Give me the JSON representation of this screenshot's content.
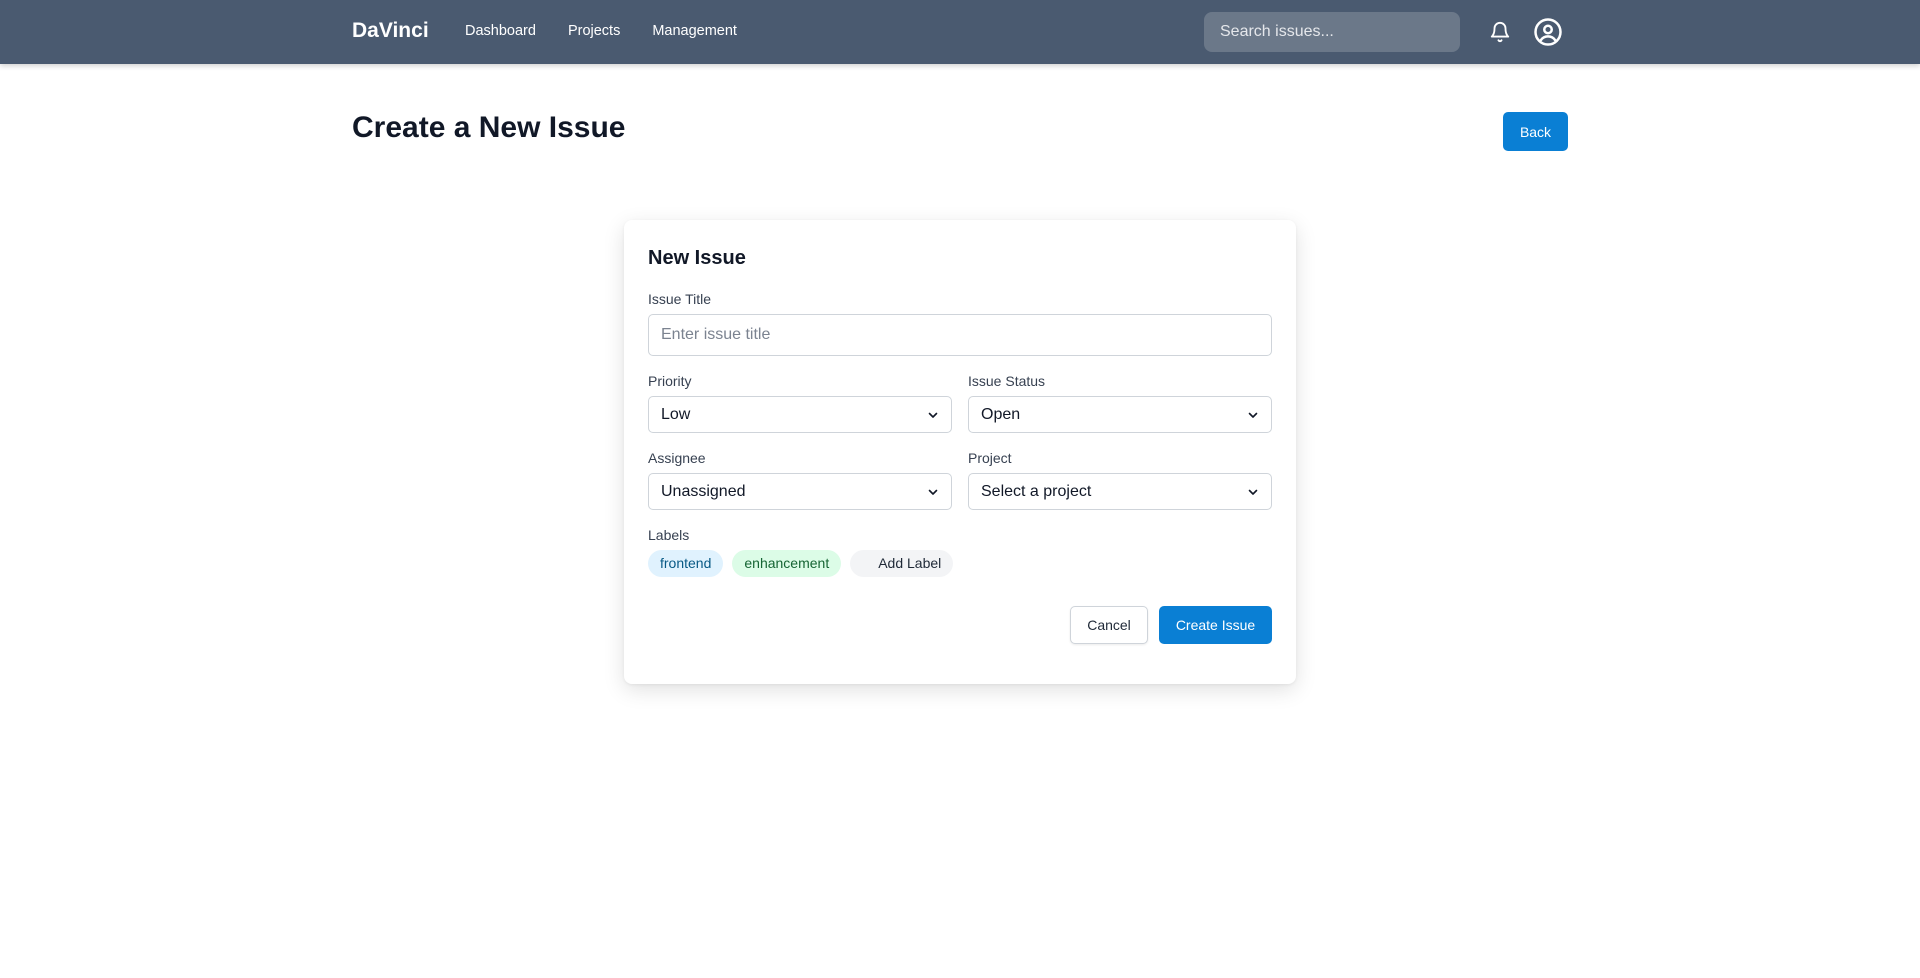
{
  "navbar": {
    "brand": "DaVinci",
    "links": [
      "Dashboard",
      "Projects",
      "Management"
    ],
    "search_placeholder": "Search issues...",
    "notification_icon": "bell-icon",
    "user_icon": "user-circle-icon"
  },
  "header": {
    "title": "Create a New Issue",
    "back_label": "Back"
  },
  "form": {
    "title": "New Issue",
    "issue_title": {
      "label": "Issue Title",
      "placeholder": "Enter issue title",
      "value": ""
    },
    "priority": {
      "label": "Priority",
      "value": "Low"
    },
    "status": {
      "label": "Issue Status",
      "value": "Open"
    },
    "assignee": {
      "label": "Assignee",
      "value": "Unassigned"
    },
    "project": {
      "label": "Project",
      "value": "Select a project"
    },
    "labels": {
      "label": "Labels",
      "items": [
        "frontend",
        "enhancement"
      ],
      "add_label": "Add Label"
    },
    "cancel_label": "Cancel",
    "create_label": "Create Issue"
  },
  "colors": {
    "navbar": "#4a5a70",
    "primary": "#0a7fd4",
    "chip_blue_bg": "#e0f2fe",
    "chip_green_bg": "#dcfce7"
  }
}
